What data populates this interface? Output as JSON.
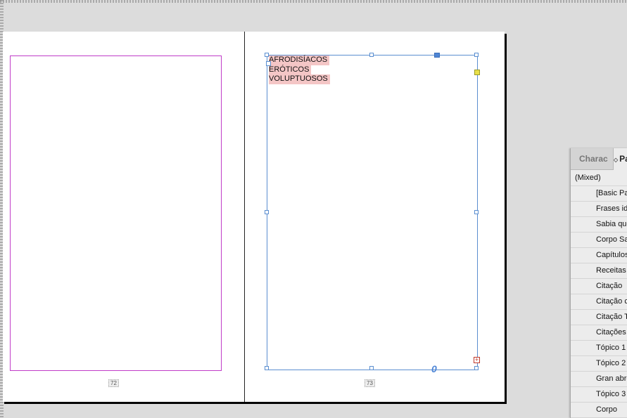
{
  "spread": {
    "left_page_folio": "72",
    "right_page_folio": "73"
  },
  "text_frame": {
    "lines": [
      "AFRODISÍACOS",
      "ERÓTICOS",
      "VOLUPTUOSOS"
    ],
    "overset_marker": "0"
  },
  "paragraph_styles_panel": {
    "tabs": [
      "Charac",
      "Pa"
    ],
    "current_value": "(Mixed)",
    "styles": [
      "[Basic Par",
      "Frases id",
      "Sabia que",
      "Corpo Sa",
      "Capítulos",
      "Receitas",
      "Citação",
      "Citação c",
      "Citação T",
      "Citações",
      "Tópico 1",
      "Tópico 2",
      "Gran abre",
      "Tópico 3",
      "Corpo"
    ]
  }
}
